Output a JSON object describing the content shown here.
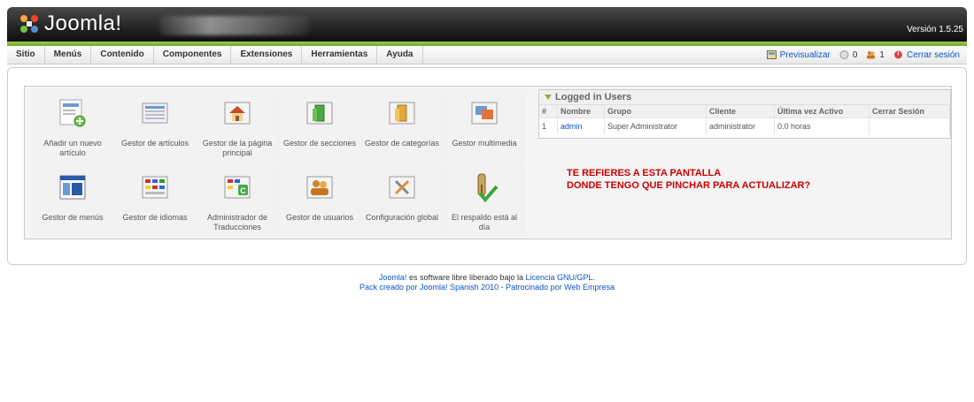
{
  "header": {
    "logo_text": "Joomla!",
    "version": "Versión 1.5.25"
  },
  "menu": [
    "Sitio",
    "Menús",
    "Contenido",
    "Componentes",
    "Extensiones",
    "Herramientas",
    "Ayuda"
  ],
  "status": {
    "preview": "Previsualizar",
    "messages_count": "0",
    "users_count": "1",
    "logout": "Cerrar sesión"
  },
  "cpanel": [
    {
      "label": "Añadir un nuevo artículo",
      "icon": "add-article-icon"
    },
    {
      "label": "Gestor de artículos",
      "icon": "article-manager-icon"
    },
    {
      "label": "Gestor de la página principal",
      "icon": "frontpage-manager-icon"
    },
    {
      "label": "Gestor de secciones",
      "icon": "section-manager-icon"
    },
    {
      "label": "Gestor de categorías",
      "icon": "category-manager-icon"
    },
    {
      "label": "Gestor multimedia",
      "icon": "media-manager-icon"
    },
    {
      "label": "Gestor de menús",
      "icon": "menu-manager-icon"
    },
    {
      "label": "Gestor de idiomas",
      "icon": "language-manager-icon"
    },
    {
      "label": "Administrador de Traducciones",
      "icon": "translation-manager-icon"
    },
    {
      "label": "Gestor de usuarios",
      "icon": "user-manager-icon"
    },
    {
      "label": "Configuración global",
      "icon": "global-config-icon"
    },
    {
      "label": "El respaldo está al día",
      "icon": "backup-ok-icon"
    }
  ],
  "logged_users": {
    "title": "Logged in Users",
    "columns": [
      "#",
      "Nombre",
      "Grupo",
      "Cliente",
      "Última vez Activo",
      "Cerrar Sesión"
    ],
    "rows": [
      {
        "num": "1",
        "name": "admin",
        "group": "Super Administrator",
        "client": "administrator",
        "last_active": "0.0 horas",
        "logout": ""
      }
    ]
  },
  "note": {
    "line1": "TE REFIERES A ESTA PANTALLA",
    "line2": "DONDE TENGO QUE PINCHAR PARA ACTUALIZAR?"
  },
  "footer": {
    "joomla": "Joomla!",
    "middle": "es software libre liberado bajo la",
    "license": "Licencia GNU/GPL",
    "dot": ".",
    "pack_prefix": "Pack creado por",
    "pack_link": "Joomla! Spanish 2010 - Patrocinado por Web Empresa"
  },
  "colors": {
    "accent_green": "#6ea72a",
    "link": "#0b55c4",
    "note_red": "#cc0000"
  }
}
